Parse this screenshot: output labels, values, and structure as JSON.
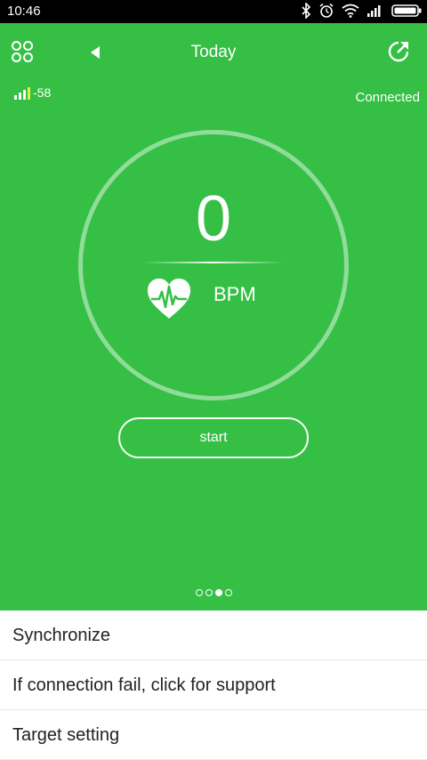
{
  "status_bar": {
    "time": "10:46",
    "icons": [
      "bluetooth-icon",
      "alarm-icon",
      "wifi-icon",
      "cell-signal-icon",
      "battery-icon"
    ]
  },
  "header": {
    "title": "Today",
    "menu_icon": "grid-menu-icon",
    "back_icon": "triangle-left-icon",
    "share_icon": "share-icon"
  },
  "device": {
    "signal_strength": "-58",
    "connection_status": "Connected"
  },
  "heart_rate": {
    "value": "0",
    "unit": "BPM",
    "icon": "heart-pulse-icon"
  },
  "start_button": {
    "label": "start"
  },
  "pager": {
    "total": 4,
    "active_index": 2
  },
  "menu_list": [
    {
      "label": "Synchronize"
    },
    {
      "label": "If connection fail, click for support"
    },
    {
      "label": "Target setting"
    }
  ],
  "colors": {
    "accent": "#35bf45",
    "text_light": "#ffffff",
    "list_text": "#222222"
  }
}
